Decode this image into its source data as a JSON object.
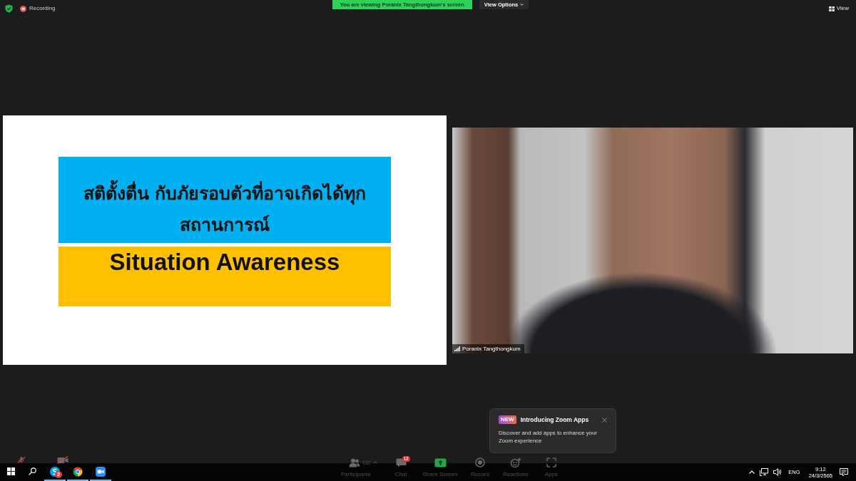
{
  "top_bar": {
    "recording_label": "Recording",
    "sharing_banner": "You are viewing Poranix Tangthongkum's screen",
    "view_options_button": "View Options",
    "view_button": "View"
  },
  "slide": {
    "title": "สติตั้งตื่น กับภัยรอบตัวที่อาจเกิดได้ทุกสถานการณ์",
    "subtitle": "Situation Awareness"
  },
  "video": {
    "participant_name": "Poranix Tangthongkum"
  },
  "popup": {
    "badge": "NEW",
    "title": "Introducing Zoom Apps",
    "body": "Discover and add apps to enhance your Zoom experience"
  },
  "toolbar": {
    "audio": {
      "muted": true
    },
    "camera": {
      "muted": true
    },
    "items": [
      {
        "kind": "participants",
        "label": "Participants",
        "count": "137"
      },
      {
        "kind": "chat",
        "label": "Chat",
        "badge": "12"
      },
      {
        "kind": "share",
        "label": "Share Screen"
      },
      {
        "kind": "record",
        "label": "Record"
      },
      {
        "kind": "reactions",
        "label": "Reactions"
      },
      {
        "kind": "apps",
        "label": "Apps"
      }
    ]
  },
  "taskbar": {
    "apps": [
      {
        "kind": "start",
        "running": false
      },
      {
        "kind": "search",
        "running": false
      },
      {
        "kind": "messenger",
        "badge": "2",
        "running": true
      },
      {
        "kind": "browser",
        "running": true
      },
      {
        "kind": "meeting",
        "running": true
      }
    ],
    "tray": {
      "language": "ENG",
      "time": "9:12",
      "date": "24/3/2565"
    }
  }
}
